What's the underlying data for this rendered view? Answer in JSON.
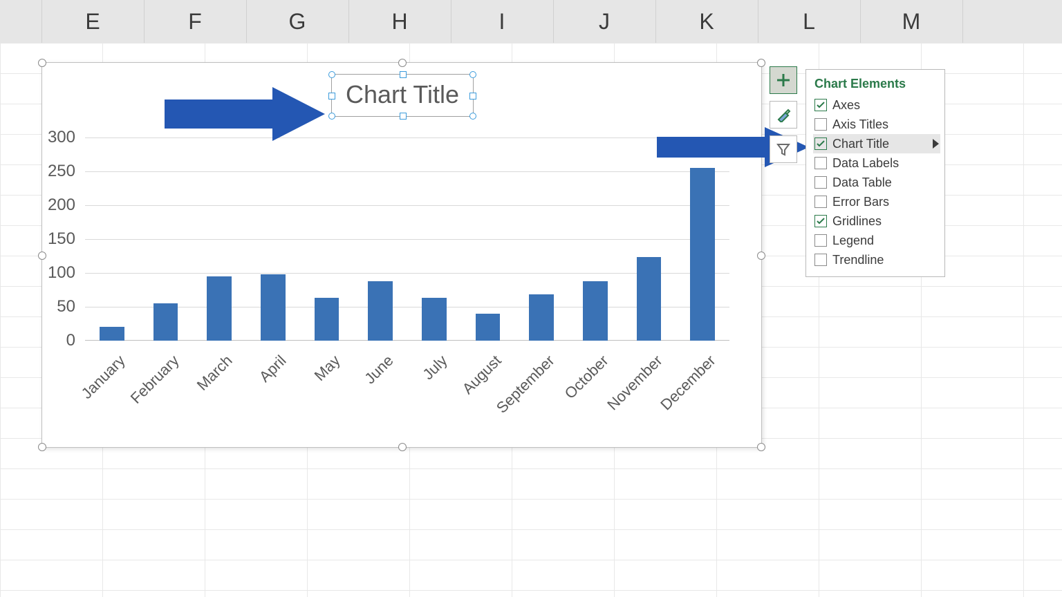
{
  "columns": [
    "E",
    "F",
    "G",
    "H",
    "I",
    "J",
    "K",
    "L",
    "M"
  ],
  "chart_title": "Chart Title",
  "y_ticks": [
    0,
    50,
    100,
    150,
    200,
    250,
    300
  ],
  "tools": {
    "plus": "chart-elements-button",
    "brush": "chart-styles-button",
    "funnel": "chart-filters-button"
  },
  "flyout": {
    "title": "Chart Elements",
    "items": [
      {
        "label": "Axes",
        "checked": true,
        "highlight": false
      },
      {
        "label": "Axis Titles",
        "checked": false,
        "highlight": false
      },
      {
        "label": "Chart Title",
        "checked": true,
        "highlight": true,
        "submenu": true
      },
      {
        "label": "Data Labels",
        "checked": false,
        "highlight": false
      },
      {
        "label": "Data Table",
        "checked": false,
        "highlight": false
      },
      {
        "label": "Error Bars",
        "checked": false,
        "highlight": false
      },
      {
        "label": "Gridlines",
        "checked": true,
        "highlight": false
      },
      {
        "label": "Legend",
        "checked": false,
        "highlight": false
      },
      {
        "label": "Trendline",
        "checked": false,
        "highlight": false
      }
    ]
  },
  "colors": {
    "bar": "#3a72b5",
    "arrow": "#2457b3",
    "accent": "#2b7a4a"
  },
  "chart_data": {
    "type": "bar",
    "title": "Chart Title",
    "categories": [
      "January",
      "February",
      "March",
      "April",
      "May",
      "June",
      "July",
      "August",
      "September",
      "October",
      "November",
      "December"
    ],
    "values": [
      20,
      55,
      95,
      98,
      63,
      88,
      63,
      40,
      68,
      88,
      123,
      255
    ],
    "xlabel": "",
    "ylabel": "",
    "ylim": [
      0,
      300
    ],
    "y_interval": 50,
    "gridlines": true,
    "legend": false
  }
}
